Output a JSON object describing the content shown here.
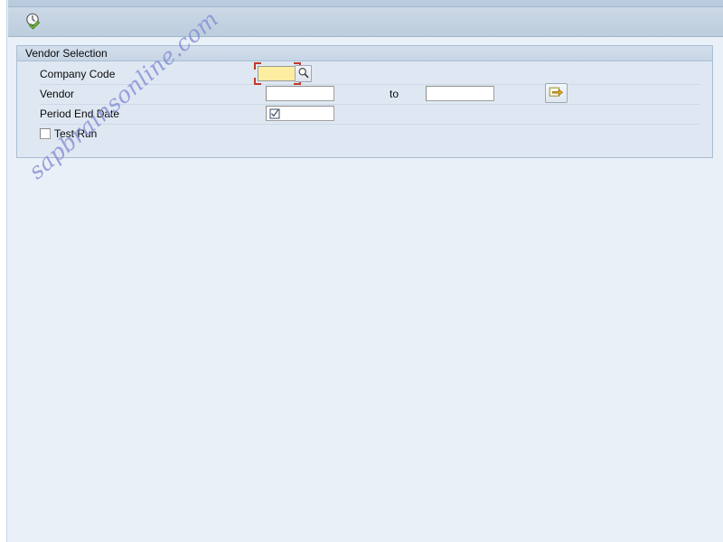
{
  "toolbar": {
    "execute_button": {
      "icon": "execute-clock-check-icon",
      "tooltip": "Execute (F8)"
    }
  },
  "groupbox": {
    "title": "Vendor Selection",
    "rows": [
      {
        "label": "Company Code",
        "value": "",
        "placeholder": "",
        "required": true,
        "focused": true,
        "has_f4_help": true,
        "f4_icon": "search-magnifier-icon"
      },
      {
        "label": "Vendor",
        "value": "",
        "placeholder": "",
        "to_label": "to",
        "to_value": "",
        "multi_select_icon": "arrow-out-of-box-icon"
      },
      {
        "label": "Period End Date",
        "value": "",
        "placeholder": "",
        "date_icon": "date-picker-checkmark-icon"
      }
    ],
    "checkbox": {
      "label": "Test Run",
      "checked": false
    }
  },
  "watermark": {
    "text": "sapbrainsonline.com"
  },
  "colors": {
    "required_field": "#fdeda0",
    "focus_bracket": "#c0392b",
    "panel_bg": "#dfe8f2",
    "page_bg": "#eaf0f7",
    "toolbar_bg": "#c3d2e1",
    "watermark": "#8a93d6"
  }
}
